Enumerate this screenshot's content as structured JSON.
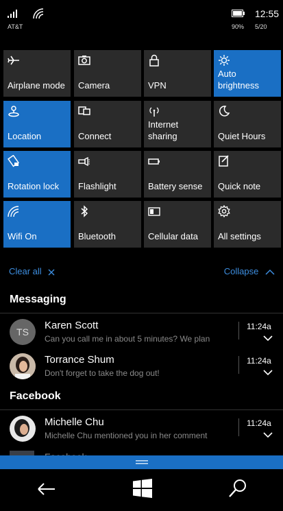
{
  "status_bar": {
    "carrier": "AT&T",
    "time": "12:55",
    "battery_pct": "90%",
    "date": "5/20",
    "icons": [
      "signal-icon",
      "wifi-icon",
      "battery-icon"
    ]
  },
  "accent_color": "#1a6fc4",
  "quick_actions": [
    {
      "label": "Airplane mode",
      "icon": "airplane-icon",
      "on": false
    },
    {
      "label": "Camera",
      "icon": "camera-icon",
      "on": false
    },
    {
      "label": "VPN",
      "icon": "lock-icon",
      "on": false
    },
    {
      "label": "Auto brightness",
      "icon": "sun-icon",
      "on": true
    },
    {
      "label": "Location",
      "icon": "location-icon",
      "on": true
    },
    {
      "label": "Connect",
      "icon": "connect-icon",
      "on": false
    },
    {
      "label": "Internet sharing",
      "icon": "hotspot-icon",
      "on": false
    },
    {
      "label": "Quiet Hours",
      "icon": "moon-icon",
      "on": false
    },
    {
      "label": "Rotation lock",
      "icon": "rotation-icon",
      "on": true
    },
    {
      "label": "Flashlight",
      "icon": "flashlight-icon",
      "on": false
    },
    {
      "label": "Battery sense",
      "icon": "battery-icon",
      "on": false
    },
    {
      "label": "Quick note",
      "icon": "note-icon",
      "on": false
    },
    {
      "label": "Wifi On",
      "icon": "wifi-icon",
      "on": true
    },
    {
      "label": "Bluetooth",
      "icon": "bluetooth-icon",
      "on": false
    },
    {
      "label": "Cellular data",
      "icon": "cellular-icon",
      "on": false
    },
    {
      "label": "All settings",
      "icon": "gear-icon",
      "on": false
    }
  ],
  "actions": {
    "clear_all": "Clear all",
    "collapse": "Collapse"
  },
  "groups": [
    {
      "title": "Messaging",
      "items": [
        {
          "name": "Karen Scott",
          "initials": "TS",
          "message": "Can you call me in about 5 minutes? We plan",
          "time": "11:24a"
        },
        {
          "name": "Torrance Shum",
          "message": "Don't forget to take the dog out!",
          "time": "11:24a"
        }
      ]
    },
    {
      "title": "Facebook",
      "items": [
        {
          "name": "Michelle Chu",
          "message": "Michelle Chu mentioned you in her comment",
          "time": "11:24a"
        }
      ]
    }
  ],
  "peek_item": {
    "name": "Facebook"
  },
  "nav": {
    "icons": [
      "back-arrow-icon",
      "windows-logo-icon",
      "search-icon"
    ]
  }
}
